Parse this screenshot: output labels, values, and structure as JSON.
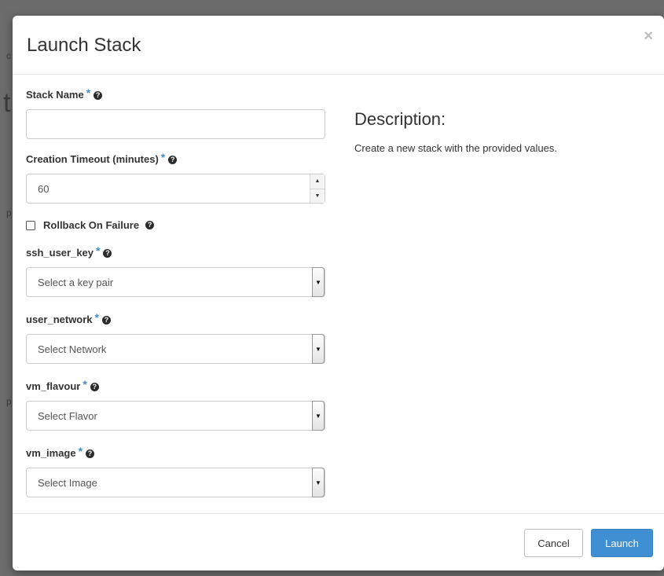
{
  "modal": {
    "title": "Launch Stack",
    "close_symbol": "×"
  },
  "form": {
    "stack_name": {
      "label": "Stack Name",
      "value": ""
    },
    "creation_timeout": {
      "label": "Creation Timeout (minutes)",
      "value": "60"
    },
    "rollback": {
      "label": "Rollback On Failure",
      "checked": false
    },
    "ssh_user_key": {
      "label": "ssh_user_key",
      "selected": "Select a key pair"
    },
    "user_network": {
      "label": "user_network",
      "selected": "Select Network"
    },
    "vm_flavour": {
      "label": "vm_flavour",
      "selected": "Select Flavor"
    },
    "vm_image": {
      "label": "vm_image",
      "selected": "Select Image"
    },
    "required_marker": "*",
    "help_symbol": "?"
  },
  "description": {
    "title": "Description:",
    "text": "Create a new stack with the provided values."
  },
  "footer": {
    "cancel_label": "Cancel",
    "launch_label": "Launch"
  },
  "colors": {
    "primary": "#3f8fd2",
    "required": "#3e8ed0",
    "backdrop": "#5a5a5a"
  },
  "icons": {
    "close": "close-icon",
    "help": "question-circle-icon",
    "select_arrow": "chevron-down-icon",
    "spinner_up": "caret-up-icon",
    "spinner_down": "caret-down-icon"
  }
}
